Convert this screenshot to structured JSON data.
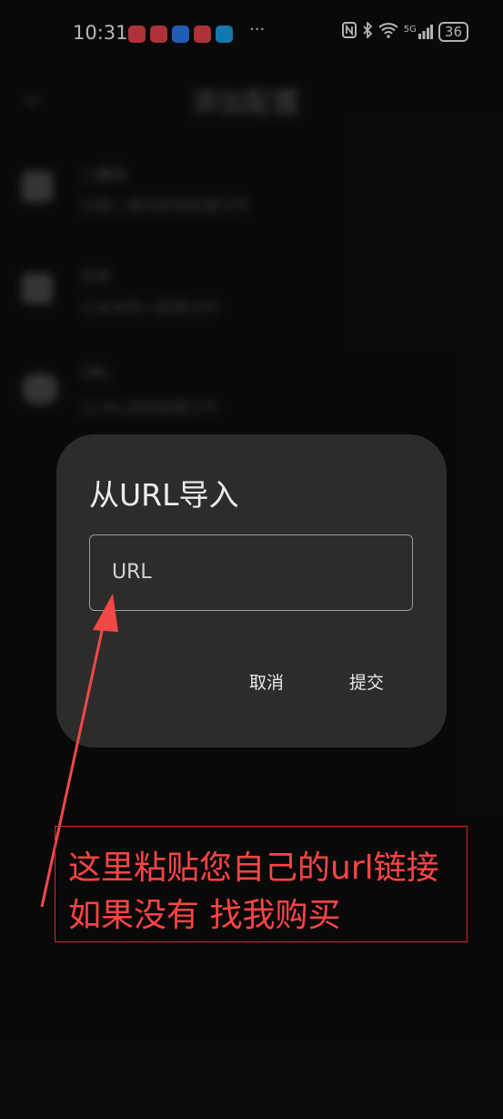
{
  "status_bar": {
    "time": "10:31",
    "more": "···",
    "network": "5G",
    "battery": "36",
    "notification_colors": [
      "#e8434b",
      "#e8434b",
      "#2a7df5",
      "#e8434b",
      "#1aa0e8"
    ]
  },
  "background_page": {
    "back_icon": "back-arrow-icon",
    "title": "添加配置",
    "items": [
      {
        "icon": "qrcode-icon",
        "title": "二维码",
        "subtitle": "扫描二维码获取配置文件"
      },
      {
        "icon": "file-icon",
        "title": "文件",
        "subtitle": "从本地导入配置文件"
      },
      {
        "icon": "cloud-icon",
        "title": "URL",
        "subtitle": "从URL获取配置文件"
      }
    ]
  },
  "dialog": {
    "title": "从URL导入",
    "url_input": {
      "placeholder": "URL",
      "value": ""
    },
    "cancel_label": "取消",
    "submit_label": "提交"
  },
  "annotation": {
    "line1": "这里粘贴您自己的url链接",
    "line2": "如果没有 找我购买",
    "color": "#ff4545"
  }
}
